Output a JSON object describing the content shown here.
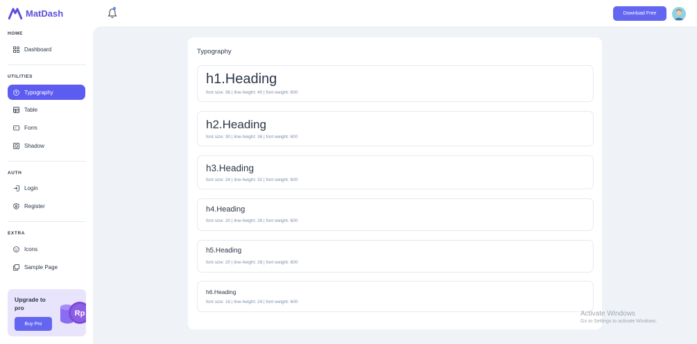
{
  "brand": {
    "name": "MatDash"
  },
  "header": {
    "download_label": "Download Free"
  },
  "sidebar": {
    "sections": [
      {
        "title": "HOME",
        "items": [
          {
            "label": "Dashboard",
            "icon": "dashboard-icon"
          }
        ]
      },
      {
        "title": "UTILITIES",
        "items": [
          {
            "label": "Typography",
            "icon": "typography-icon",
            "active": true
          },
          {
            "label": "Table",
            "icon": "table-icon"
          },
          {
            "label": "Form",
            "icon": "form-icon"
          },
          {
            "label": "Shadow",
            "icon": "shadow-icon"
          }
        ]
      },
      {
        "title": "AUTH",
        "items": [
          {
            "label": "Login",
            "icon": "login-icon"
          },
          {
            "label": "Register",
            "icon": "register-icon"
          }
        ]
      },
      {
        "title": "EXTRA",
        "items": [
          {
            "label": "Icons",
            "icon": "smile-icon"
          },
          {
            "label": "Sample Page",
            "icon": "sample-page-icon"
          }
        ]
      }
    ],
    "promo": {
      "title": "Upgrade to pro",
      "button": "Buy Pro",
      "badge": "Rp"
    }
  },
  "main": {
    "card_title": "Typography",
    "headings": [
      {
        "text": "h1.Heading",
        "meta": "font size: 36 | line-height: 40 | font weight: 600"
      },
      {
        "text": "h2.Heading",
        "meta": "font size: 30 | line-height: 36 | font weight: 600"
      },
      {
        "text": "h3.Heading",
        "meta": "font size: 24 | line-height: 32 | font weight: 600"
      },
      {
        "text": "h4.Heading",
        "meta": "font size: 20 | line-height: 28 | font weight: 600"
      },
      {
        "text": "h5.Heading",
        "meta": "font size: 20 | line-height: 28 | font weight: 600"
      },
      {
        "text": "h6.Heading",
        "meta": "font size: 16 | line-height: 24 | font weight: 600"
      }
    ]
  },
  "watermark": {
    "line1": "Activate Windows",
    "line2": "Go to Settings to activate Windows."
  },
  "colors": {
    "accent": "#5d5cf1",
    "background": "#eff3f8",
    "text": "#2a3547",
    "muted": "#7c8fac"
  }
}
